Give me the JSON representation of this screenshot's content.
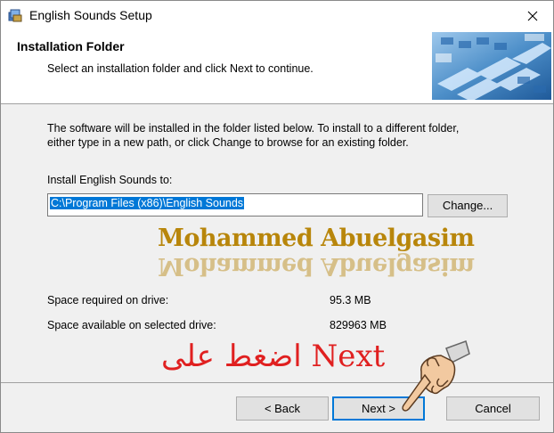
{
  "window": {
    "title": "English Sounds Setup",
    "close_glyph": "✕"
  },
  "header": {
    "title": "Installation Folder",
    "subtitle": "Select an installation folder and click Next to continue."
  },
  "body": {
    "description_line1": "The software will be installed in the folder listed below. To install to a different folder,",
    "description_line2": "either type in a new path, or click Change to browse for an existing folder.",
    "install_label": "Install English Sounds to:",
    "install_path": "C:\\Program Files (x86)\\English Sounds",
    "change_label": "Change...",
    "watermark": "Mohammed Abuelgasim",
    "space_required_label": "Space required on drive:",
    "space_required_value": "95.3 MB",
    "space_available_label": "Space available on selected drive:",
    "space_available_value": "829963 MB",
    "annotation": "اضغط على Next"
  },
  "footer": {
    "back_label": "< Back",
    "next_label": "Next >",
    "cancel_label": "Cancel"
  },
  "colors": {
    "accent": "#0078d7",
    "annotation": "#e02020",
    "watermark": "#b8860b"
  },
  "icons": [
    "installer-app-icon",
    "close-icon",
    "banner-keyboard-image",
    "pointing-hand-icon"
  ]
}
